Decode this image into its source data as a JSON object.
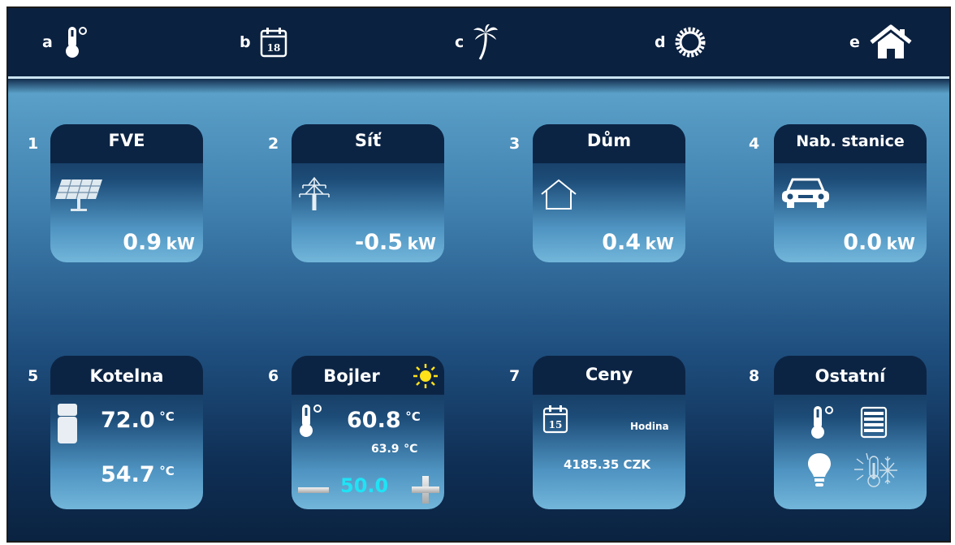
{
  "nav": [
    {
      "letter": "a",
      "icon": "thermometer-icon"
    },
    {
      "letter": "b",
      "icon": "calendar-icon",
      "day": "18"
    },
    {
      "letter": "c",
      "icon": "palm-tree-icon"
    },
    {
      "letter": "d",
      "icon": "gear-icon"
    },
    {
      "letter": "e",
      "icon": "home-icon"
    }
  ],
  "tiles": {
    "fve": {
      "number": "1",
      "title": "FVE",
      "value": "0.9",
      "unit": "kW",
      "icon": "solar-panel-icon"
    },
    "sit": {
      "number": "2",
      "title": "Síť",
      "value": "-0.5",
      "unit": "kW",
      "icon": "power-pylon-icon"
    },
    "dum": {
      "number": "3",
      "title": "Dům",
      "value": "0.4",
      "unit": "kW",
      "icon": "house-outline-icon"
    },
    "nab": {
      "number": "4",
      "title": "Nab. stanice",
      "value": "0.0",
      "unit": "kW",
      "icon": "car-icon"
    },
    "kotelna": {
      "number": "5",
      "title": "Kotelna",
      "temp1": "72.0",
      "temp2": "54.7",
      "unit": "°C",
      "icon": "boiler-icon"
    },
    "bojler": {
      "number": "6",
      "title": "Bojler",
      "temp": "60.8",
      "temp_small": "63.9",
      "unit": "°C",
      "setpoint": "50.0",
      "icon": "sun-icon",
      "setpoint_color": "#1fe3f5"
    },
    "ceny": {
      "number": "7",
      "title": "Ceny",
      "day": "15",
      "hour_label": "Hodina",
      "price": "4185.35 CZK",
      "icon": "calendar-icon"
    },
    "ostatni": {
      "number": "8",
      "title": "Ostatní",
      "icons": [
        "thermometer-icon",
        "blinds-icon",
        "light-bulb-icon",
        "heat-cool-icon"
      ]
    }
  },
  "colors": {
    "header": "#0b2140",
    "accent": "#1fe3f5",
    "sun": "#ffe21a"
  }
}
